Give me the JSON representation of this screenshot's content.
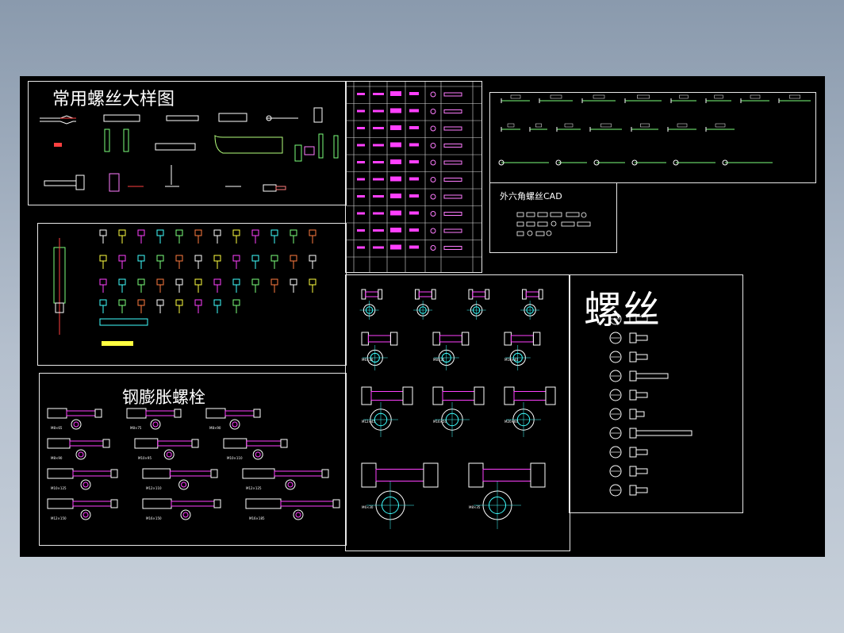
{
  "drawing": {
    "panel_common_screws": {
      "title": "常用螺丝大样图"
    },
    "panel_expansion_bolts": {
      "title": "钢膨胀螺栓",
      "labels": [
        "M8×65",
        "M8×75",
        "M8×90",
        "M8×90",
        "M10×95",
        "M10×110",
        "M10×125",
        "M12×110",
        "M12×125",
        "M12×150",
        "M16×150",
        "M16×185",
        "M16×210",
        "M16×200"
      ]
    },
    "panel_hex_cad": {
      "title": "外六角螺丝CAD"
    },
    "panel_screws_big": {
      "title": "螺丝"
    },
    "panel_hex_bolts": {
      "labels": [
        "M6×30",
        "M8×35",
        "M10×40",
        "M12×45",
        "M16×50",
        "M20×60"
      ]
    }
  }
}
